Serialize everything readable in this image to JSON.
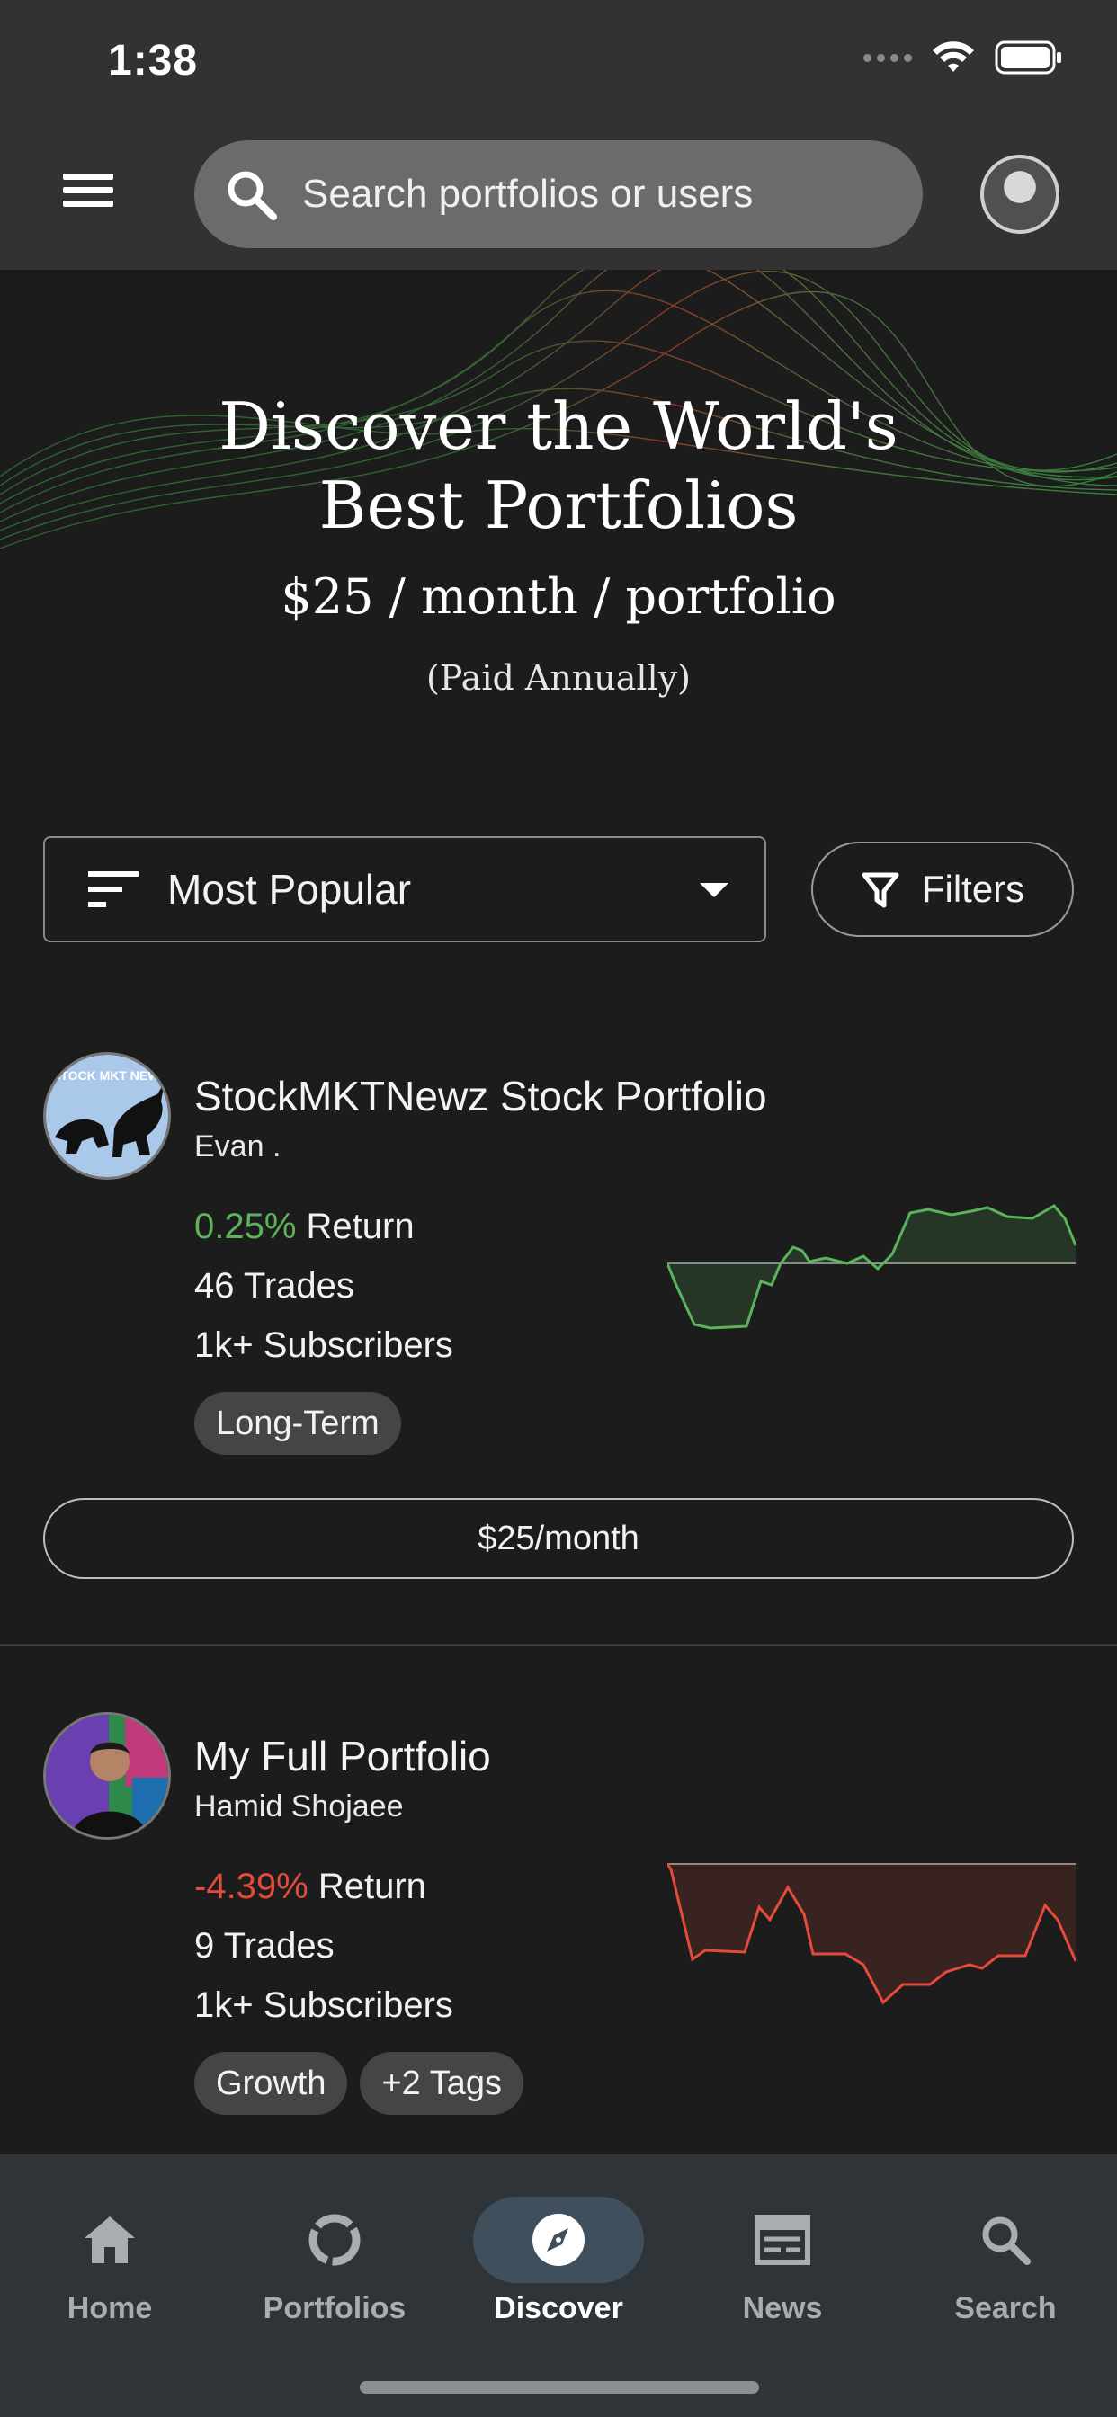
{
  "status_bar": {
    "time": "1:38"
  },
  "app_bar": {
    "search_placeholder": "Search portfolios or users",
    "menu_icon": "hamburger-menu-icon",
    "search_icon": "search-icon"
  },
  "hero": {
    "title_line1": "Discover the World's",
    "title_line2": "Best Portfolios",
    "price": "$25 / month / portfolio",
    "note": "(Paid Annually)"
  },
  "controls": {
    "sort_label": "Most Popular",
    "filters_label": "Filters"
  },
  "portfolios": [
    {
      "title": "StockMKTNewz Stock Portfolio",
      "author": "Evan .",
      "return_value": "0.25%",
      "return_label": " Return",
      "trades": "46 Trades",
      "subscribers": "1k+ Subscribers",
      "tags": [
        "Long-Term"
      ],
      "price_button": "$25/month",
      "avatar_text": "STOCK MKT NEWZ",
      "trend": "positive",
      "color": "#5bb35b"
    },
    {
      "title": "My Full Portfolio",
      "author": "Hamid Shojaee",
      "return_value": "-4.39%",
      "return_label": " Return",
      "trades": "9 Trades",
      "subscribers": "1k+ Subscribers",
      "tags": [
        "Growth",
        "+2 Tags"
      ],
      "trend": "negative",
      "color": "#e44b3a"
    }
  ],
  "bottom_nav": {
    "items": [
      {
        "label": "Home",
        "icon": "home-icon"
      },
      {
        "label": "Portfolios",
        "icon": "portfolio-ring-icon"
      },
      {
        "label": "Discover",
        "icon": "compass-icon",
        "active": true
      },
      {
        "label": "News",
        "icon": "newspaper-icon"
      },
      {
        "label": "Search",
        "icon": "search-icon"
      }
    ]
  },
  "colors": {
    "positive": "#5bb35b",
    "negative": "#e44b3a",
    "nav_background": "#2f3438",
    "active_nav_pill": "#3f4f5c"
  }
}
